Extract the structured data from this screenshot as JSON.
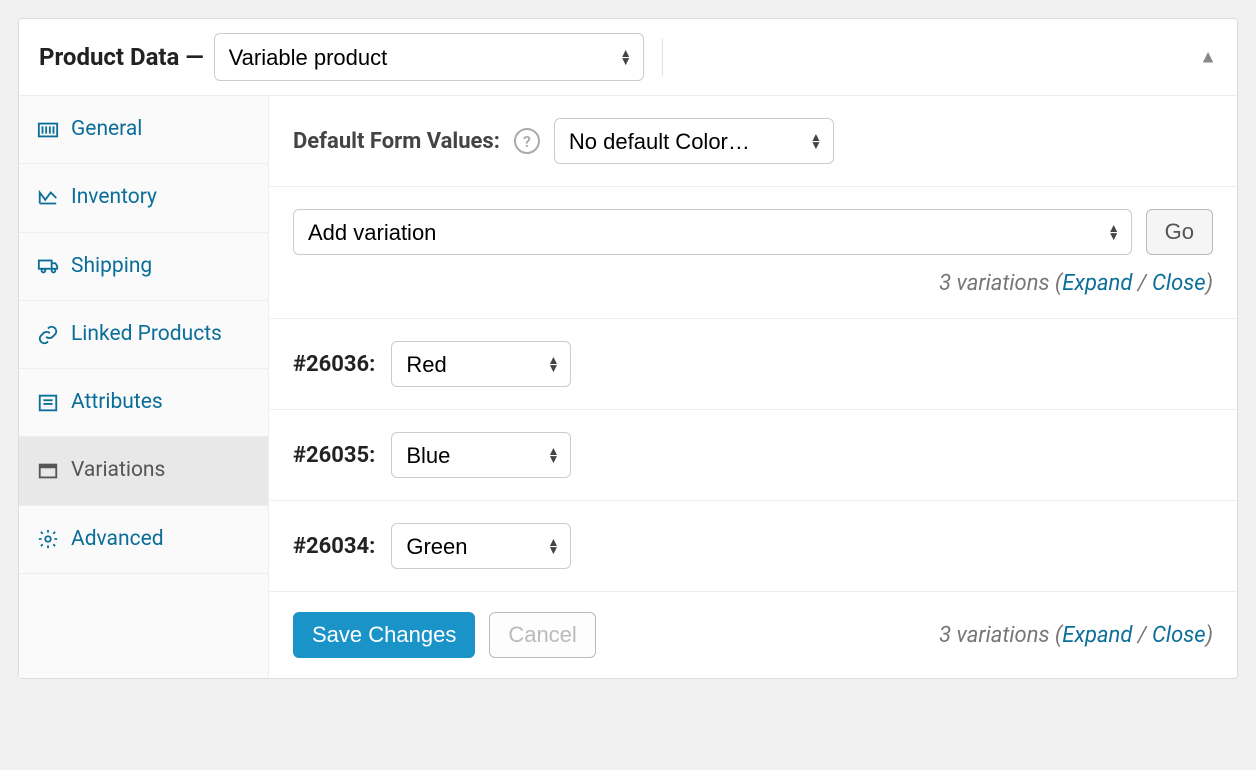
{
  "header": {
    "title": "Product Data —",
    "product_type": "Variable product"
  },
  "sidebar": {
    "tabs": [
      {
        "key": "general",
        "label": "General"
      },
      {
        "key": "inventory",
        "label": "Inventory"
      },
      {
        "key": "shipping",
        "label": "Shipping"
      },
      {
        "key": "linked",
        "label": "Linked Products"
      },
      {
        "key": "attributes",
        "label": "Attributes"
      },
      {
        "key": "variations",
        "label": "Variations",
        "active": true
      },
      {
        "key": "advanced",
        "label": "Advanced"
      }
    ]
  },
  "defaults": {
    "label": "Default Form Values:",
    "select_value": "No default Color…"
  },
  "add_variation": {
    "select_value": "Add variation",
    "go_label": "Go"
  },
  "summary": {
    "count_text": "3 variations",
    "open_paren": " (",
    "expand": "Expand",
    "sep": " / ",
    "close": "Close",
    "close_paren": ")"
  },
  "variations": [
    {
      "id": "#26036:",
      "value": "Red"
    },
    {
      "id": "#26035:",
      "value": "Blue"
    },
    {
      "id": "#26034:",
      "value": "Green"
    }
  ],
  "footer": {
    "save": "Save Changes",
    "cancel": "Cancel"
  }
}
